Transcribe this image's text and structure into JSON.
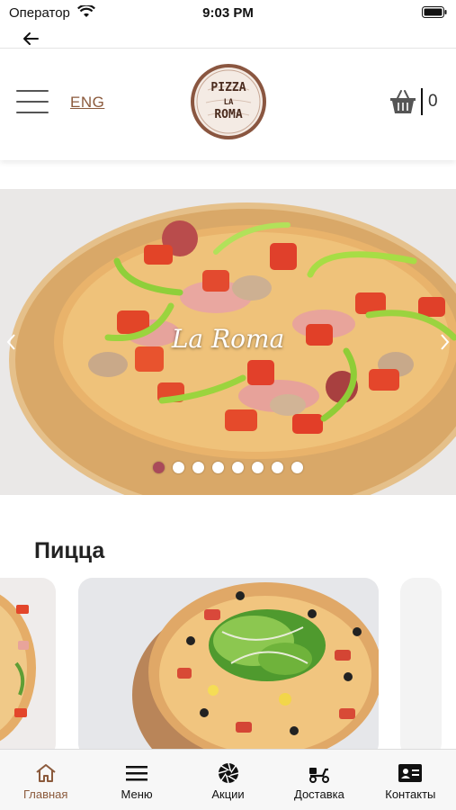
{
  "status_bar": {
    "carrier": "Оператор",
    "time": "9:03 PM"
  },
  "header": {
    "language": "ENG",
    "cart_count": "0",
    "logo_text": [
      "PIZZA",
      "LA",
      "ROMA"
    ]
  },
  "carousel": {
    "title": "La Roma",
    "slide_count": 8,
    "active_index": 0
  },
  "section": {
    "title": "Пицца"
  },
  "tabs": [
    {
      "label": "Главная",
      "icon": "home-icon",
      "active": true
    },
    {
      "label": "Меню",
      "icon": "menu-icon",
      "active": false
    },
    {
      "label": "Акции",
      "icon": "aperture-icon",
      "active": false
    },
    {
      "label": "Доставка",
      "icon": "scooter-icon",
      "active": false
    },
    {
      "label": "Контакты",
      "icon": "contact-card-icon",
      "active": false
    }
  ],
  "colors": {
    "accent": "#8b5a3c",
    "active_dot": "#a94a5a"
  }
}
